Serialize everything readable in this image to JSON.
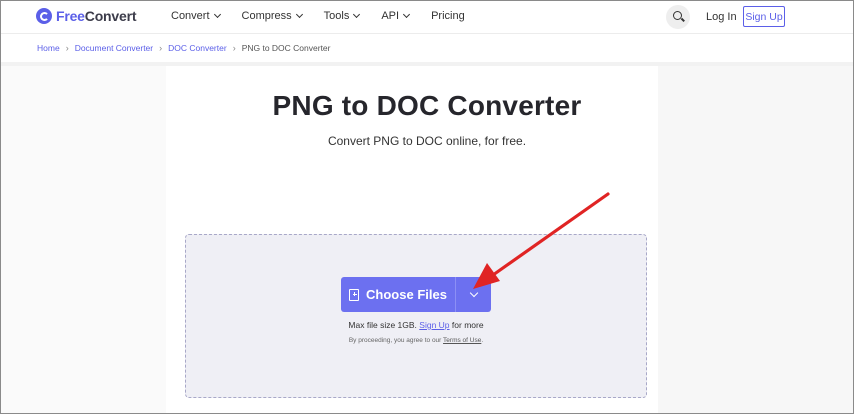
{
  "brand": {
    "name_prefix": "Free",
    "name_suffix": "Convert"
  },
  "nav": {
    "items": [
      {
        "label": "Convert"
      },
      {
        "label": "Compress"
      },
      {
        "label": "Tools"
      },
      {
        "label": "API"
      },
      {
        "label": "Pricing"
      }
    ],
    "login": "Log In",
    "signup": "Sign Up"
  },
  "breadcrumb": {
    "items": [
      "Home",
      "Document Converter",
      "DOC Converter"
    ],
    "current": "PNG to DOC Converter"
  },
  "main": {
    "title": "PNG to DOC Converter",
    "subtitle": "Convert PNG to DOC online, for free.",
    "choose_files": "Choose Files",
    "max_size_prefix": "Max file size 1GB.",
    "max_size_link": "Sign Up",
    "max_size_suffix": "for more",
    "terms_prefix": "By proceeding, you agree to our",
    "terms_link": "Terms of Use",
    "terms_suffix": "."
  },
  "colors": {
    "brand": "#5b5fe8",
    "button": "#6c70f0",
    "arrow": "#e02424"
  }
}
